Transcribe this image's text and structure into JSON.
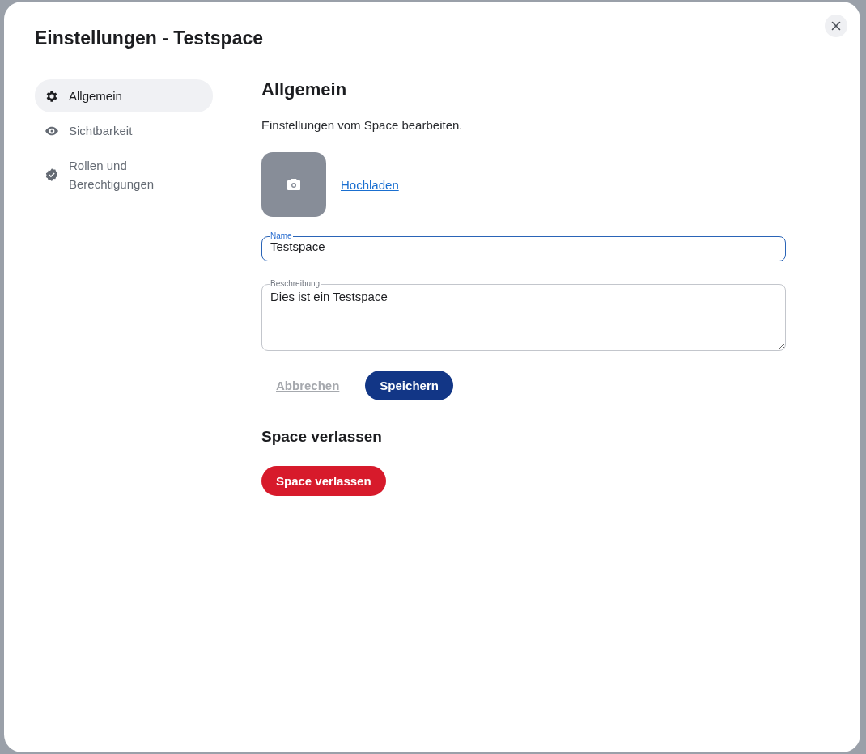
{
  "dialog": {
    "title": "Einstellungen - Testspace"
  },
  "sidebar": {
    "items": [
      {
        "label": "Allgemein",
        "kind": "gear",
        "selected": true
      },
      {
        "label": "Sichtbarkeit",
        "kind": "eye",
        "selected": false
      },
      {
        "label": "Rollen und Berechtigungen",
        "kind": "badge",
        "selected": false
      }
    ]
  },
  "section": {
    "heading": "Allgemein",
    "description": "Einstellungen vom Space bearbeiten."
  },
  "avatar": {
    "upload_link": "Hochladen"
  },
  "fields": [
    {
      "kind": "input",
      "label": "Name",
      "value": "Testspace",
      "focused": true
    },
    {
      "kind": "textarea",
      "label": "Beschreibung",
      "value": "Dies ist ein Testspace",
      "focused": false
    }
  ],
  "actions": [
    {
      "label": "Abbrechen",
      "kind": "link",
      "disabled": true
    },
    {
      "label": "Speichern",
      "kind": "primary",
      "disabled": false
    }
  ],
  "leave": {
    "heading": "Space verlassen",
    "button": "Space verlassen"
  }
}
